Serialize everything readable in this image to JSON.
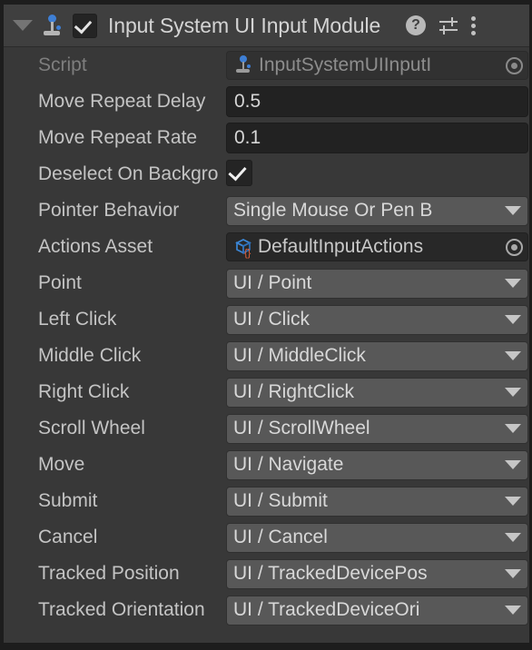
{
  "header": {
    "foldout_icon": "triangle-down-icon",
    "component_icon": "input-module-joystick-icon",
    "enabled_checkbox": "checked",
    "title": "Input System UI Input Module",
    "help_icon": "?",
    "help_icon_name": "help-icon",
    "preset_icon_name": "preset-settings-icon",
    "menu_icon_name": "context-menu-kebab-icon"
  },
  "colors": {
    "panel_background": "#383838",
    "header_background": "#3f3f3f",
    "popup_background": "#585858",
    "text_field_background": "#222222",
    "label_text": "#c4c4c4",
    "disabled_text": "#7e7e7e",
    "accent_blue": "#3e7fd5",
    "accent_orange": "#e8633a"
  },
  "rows": [
    {
      "label": "Script",
      "type": "object",
      "value": "InputSystemUIInputI",
      "icon": "script-mono-behaviour-icon",
      "picker": "object-picker-icon",
      "disabled": true
    },
    {
      "label": "Move Repeat Delay",
      "type": "number",
      "value": "0.5",
      "disabled": false
    },
    {
      "label": "Move Repeat Rate",
      "type": "number",
      "value": "0.1",
      "disabled": false
    },
    {
      "label": "Deselect On Backgro",
      "type": "checkbox",
      "value": "checked",
      "disabled": false
    },
    {
      "label": "Pointer Behavior",
      "type": "popup",
      "value": "Single Mouse Or Pen B",
      "disabled": false
    },
    {
      "label": "Actions Asset",
      "type": "object",
      "value": "DefaultInputActions",
      "icon": "input-actions-asset-icon",
      "picker": "object-picker-icon",
      "disabled": false
    },
    {
      "label": "Point",
      "type": "popup",
      "value": "UI / Point",
      "disabled": false
    },
    {
      "label": "Left Click",
      "type": "popup",
      "value": "UI / Click",
      "disabled": false
    },
    {
      "label": "Middle Click",
      "type": "popup",
      "value": "UI / MiddleClick",
      "disabled": false
    },
    {
      "label": "Right Click",
      "type": "popup",
      "value": "UI / RightClick",
      "disabled": false
    },
    {
      "label": "Scroll Wheel",
      "type": "popup",
      "value": "UI / ScrollWheel",
      "disabled": false
    },
    {
      "label": "Move",
      "type": "popup",
      "value": "UI / Navigate",
      "disabled": false
    },
    {
      "label": "Submit",
      "type": "popup",
      "value": "UI / Submit",
      "disabled": false
    },
    {
      "label": "Cancel",
      "type": "popup",
      "value": "UI / Cancel",
      "disabled": false
    },
    {
      "label": "Tracked Position",
      "type": "popup",
      "value": "UI / TrackedDevicePos",
      "disabled": false
    },
    {
      "label": "Tracked Orientation",
      "type": "popup",
      "value": "UI / TrackedDeviceOri",
      "disabled": false
    }
  ]
}
